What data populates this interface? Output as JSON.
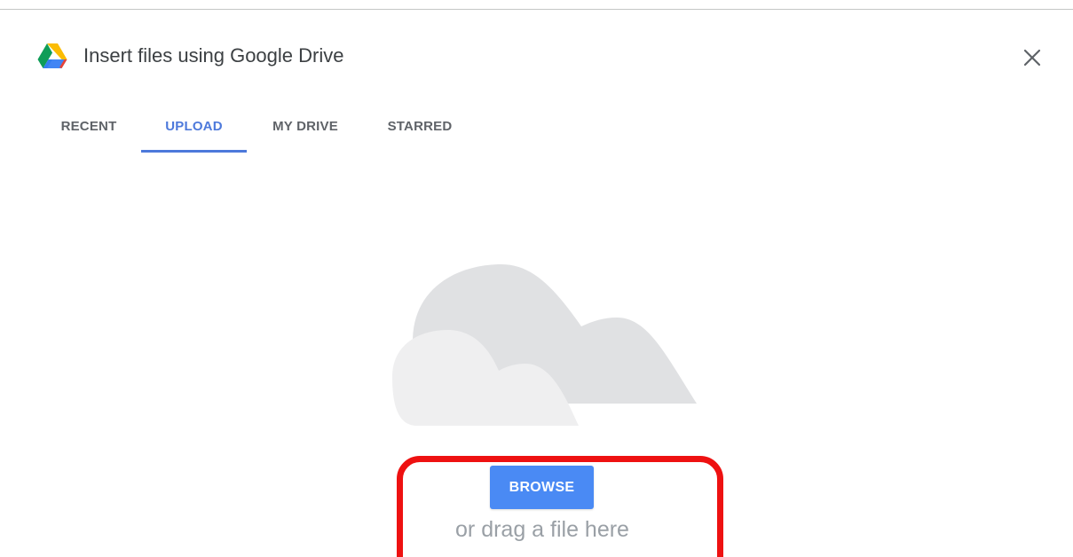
{
  "dialog": {
    "title": "Insert files using Google Drive",
    "logo_icon": "google-drive-logo",
    "close_icon": "close-icon"
  },
  "tabs": [
    {
      "label": "RECENT",
      "active": false
    },
    {
      "label": "UPLOAD",
      "active": true
    },
    {
      "label": "MY DRIVE",
      "active": false
    },
    {
      "label": "STARRED",
      "active": false
    }
  ],
  "upload": {
    "illustration_icon": "cloud-illustration",
    "browse_label": "BROWSE",
    "drag_hint": "or drag a file here"
  },
  "colors": {
    "accent": "#4d79db",
    "button": "#4a8af4",
    "highlight": "#ee1111",
    "tab_text": "#5f6368",
    "hint_text": "#9aa0a6"
  }
}
